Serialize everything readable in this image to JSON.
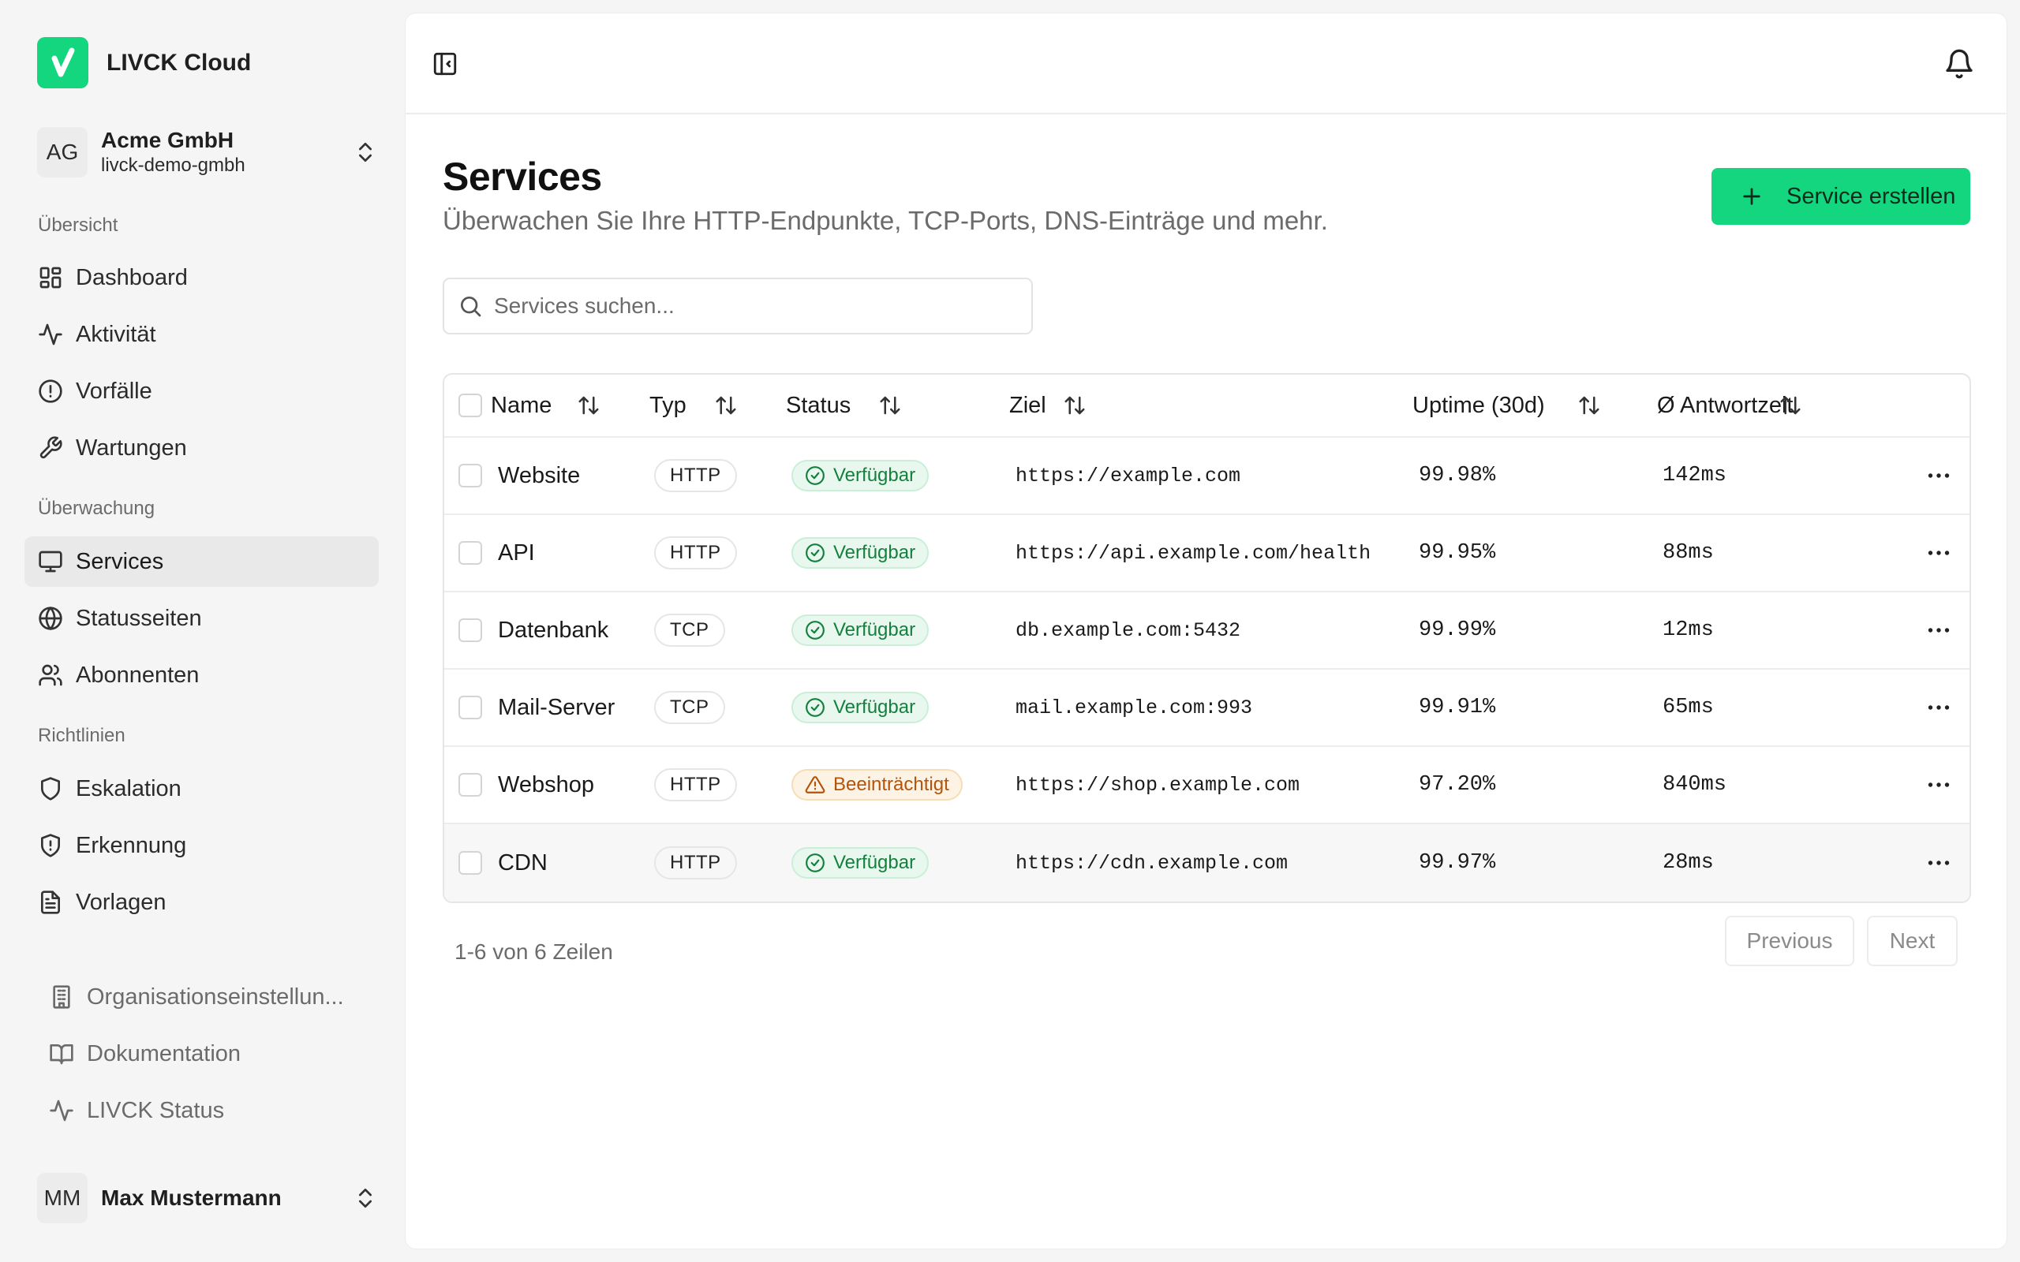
{
  "brand": {
    "name": "LIVCK Cloud",
    "logo_color": "#14d67e"
  },
  "org": {
    "initials": "AG",
    "name": "Acme GmbH",
    "slug": "livck-demo-gmbh"
  },
  "sidebar": {
    "sections": [
      {
        "label": "Übersicht",
        "items": [
          {
            "label": "Dashboard",
            "icon": "dashboard-grid-icon"
          },
          {
            "label": "Aktivität",
            "icon": "activity-icon"
          },
          {
            "label": "Vorfälle",
            "icon": "alert-circle-icon"
          },
          {
            "label": "Wartungen",
            "icon": "wrench-icon"
          }
        ]
      },
      {
        "label": "Überwachung",
        "items": [
          {
            "label": "Services",
            "icon": "monitor-icon",
            "active": true
          },
          {
            "label": "Statusseiten",
            "icon": "globe-icon"
          },
          {
            "label": "Abonnenten",
            "icon": "users-icon"
          }
        ]
      },
      {
        "label": "Richtlinien",
        "items": [
          {
            "label": "Eskalation",
            "icon": "shield-icon"
          },
          {
            "label": "Erkennung",
            "icon": "shield-alert-icon"
          },
          {
            "label": "Vorlagen",
            "icon": "file-text-icon"
          }
        ]
      }
    ],
    "secondary": [
      {
        "label": "Organisationseinstellun...",
        "icon": "building-icon"
      },
      {
        "label": "Dokumentation",
        "icon": "book-open-icon"
      },
      {
        "label": "LIVCK Status",
        "icon": "activity-icon"
      }
    ]
  },
  "user": {
    "initials": "MM",
    "name": "Max Mustermann"
  },
  "page": {
    "title": "Services",
    "subtitle": "Überwachen Sie Ihre HTTP-Endpunkte, TCP-Ports, DNS-Einträge und mehr.",
    "create_label": "Service erstellen"
  },
  "search": {
    "placeholder": "Services suchen..."
  },
  "table": {
    "columns": [
      "Name",
      "Typ",
      "Status",
      "Ziel",
      "Uptime (30d)",
      "Ø Antwortzeit"
    ],
    "rows": [
      {
        "name": "Website",
        "type": "HTTP",
        "status": "Verfügbar",
        "status_kind": "ok",
        "target": "https://example.com",
        "uptime": "99.98%",
        "response": "142ms"
      },
      {
        "name": "API",
        "type": "HTTP",
        "status": "Verfügbar",
        "status_kind": "ok",
        "target": "https://api.example.com/health",
        "uptime": "99.95%",
        "response": "88ms"
      },
      {
        "name": "Datenbank",
        "type": "TCP",
        "status": "Verfügbar",
        "status_kind": "ok",
        "target": "db.example.com:5432",
        "uptime": "99.99%",
        "response": "12ms"
      },
      {
        "name": "Mail-Server",
        "type": "TCP",
        "status": "Verfügbar",
        "status_kind": "ok",
        "target": "mail.example.com:993",
        "uptime": "99.91%",
        "response": "65ms"
      },
      {
        "name": "Webshop",
        "type": "HTTP",
        "status": "Beeinträchtigt",
        "status_kind": "warn",
        "target": "https://shop.example.com",
        "uptime": "97.20%",
        "response": "840ms"
      },
      {
        "name": "CDN",
        "type": "HTTP",
        "status": "Verfügbar",
        "status_kind": "ok",
        "target": "https://cdn.example.com",
        "uptime": "99.97%",
        "response": "28ms"
      }
    ]
  },
  "pagination": {
    "summary": "1-6 von 6 Zeilen",
    "previous": "Previous",
    "next": "Next"
  },
  "colors": {
    "accent": "#14d67e",
    "ok": "#15803d",
    "warn": "#b45309"
  }
}
